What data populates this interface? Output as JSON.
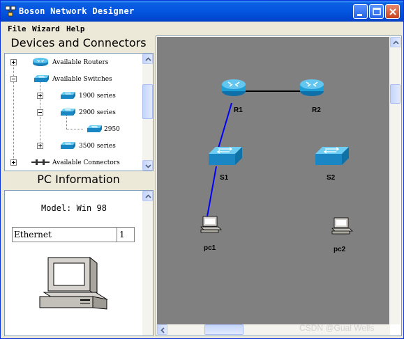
{
  "window": {
    "title": "Boson Network Designer"
  },
  "menu": {
    "file": "File",
    "wizard": "Wizard",
    "help": "Help"
  },
  "devices_panel": {
    "header": "Devices and Connectors",
    "tree": [
      {
        "label": "Available Routers",
        "expander": "plus",
        "icon": "router-icon"
      },
      {
        "label": "Available Switches",
        "expander": "minus",
        "icon": "switch-icon"
      },
      {
        "label": "1900 series",
        "expander": "plus",
        "icon": "switch-icon"
      },
      {
        "label": "2900 series",
        "expander": "minus",
        "icon": "switch-icon"
      },
      {
        "label": "2950",
        "expander": "none",
        "icon": "switch-icon"
      },
      {
        "label": "3500 series",
        "expander": "plus",
        "icon": "switch-icon"
      },
      {
        "label": "Available Connectors",
        "expander": "plus",
        "icon": "connector-icon"
      }
    ]
  },
  "pc_panel": {
    "header": "PC Information",
    "model": "Model: Win 98",
    "interface_name": "Ethernet",
    "interface_count": "1"
  },
  "topology": {
    "devices": [
      {
        "id": "R1",
        "label": "R1",
        "type": "router"
      },
      {
        "id": "R2",
        "label": "R2",
        "type": "router"
      },
      {
        "id": "S1",
        "label": "S1",
        "type": "switch"
      },
      {
        "id": "S2",
        "label": "S2",
        "type": "switch"
      },
      {
        "id": "pc1",
        "label": "pc1",
        "type": "pc"
      },
      {
        "id": "pc2",
        "label": "pc2",
        "type": "pc"
      }
    ],
    "links": [
      {
        "from": "R1",
        "to": "R2",
        "color": "#000000"
      },
      {
        "from": "R1",
        "to": "S1",
        "color": "#0000ff"
      },
      {
        "from": "S1",
        "to": "pc1",
        "color": "#0000ff"
      }
    ],
    "background": "#808080"
  },
  "watermark": "CSDN @Gual Wells",
  "colors": {
    "titlebar": "#0456e0",
    "device_blue": "#1e9fd6"
  }
}
